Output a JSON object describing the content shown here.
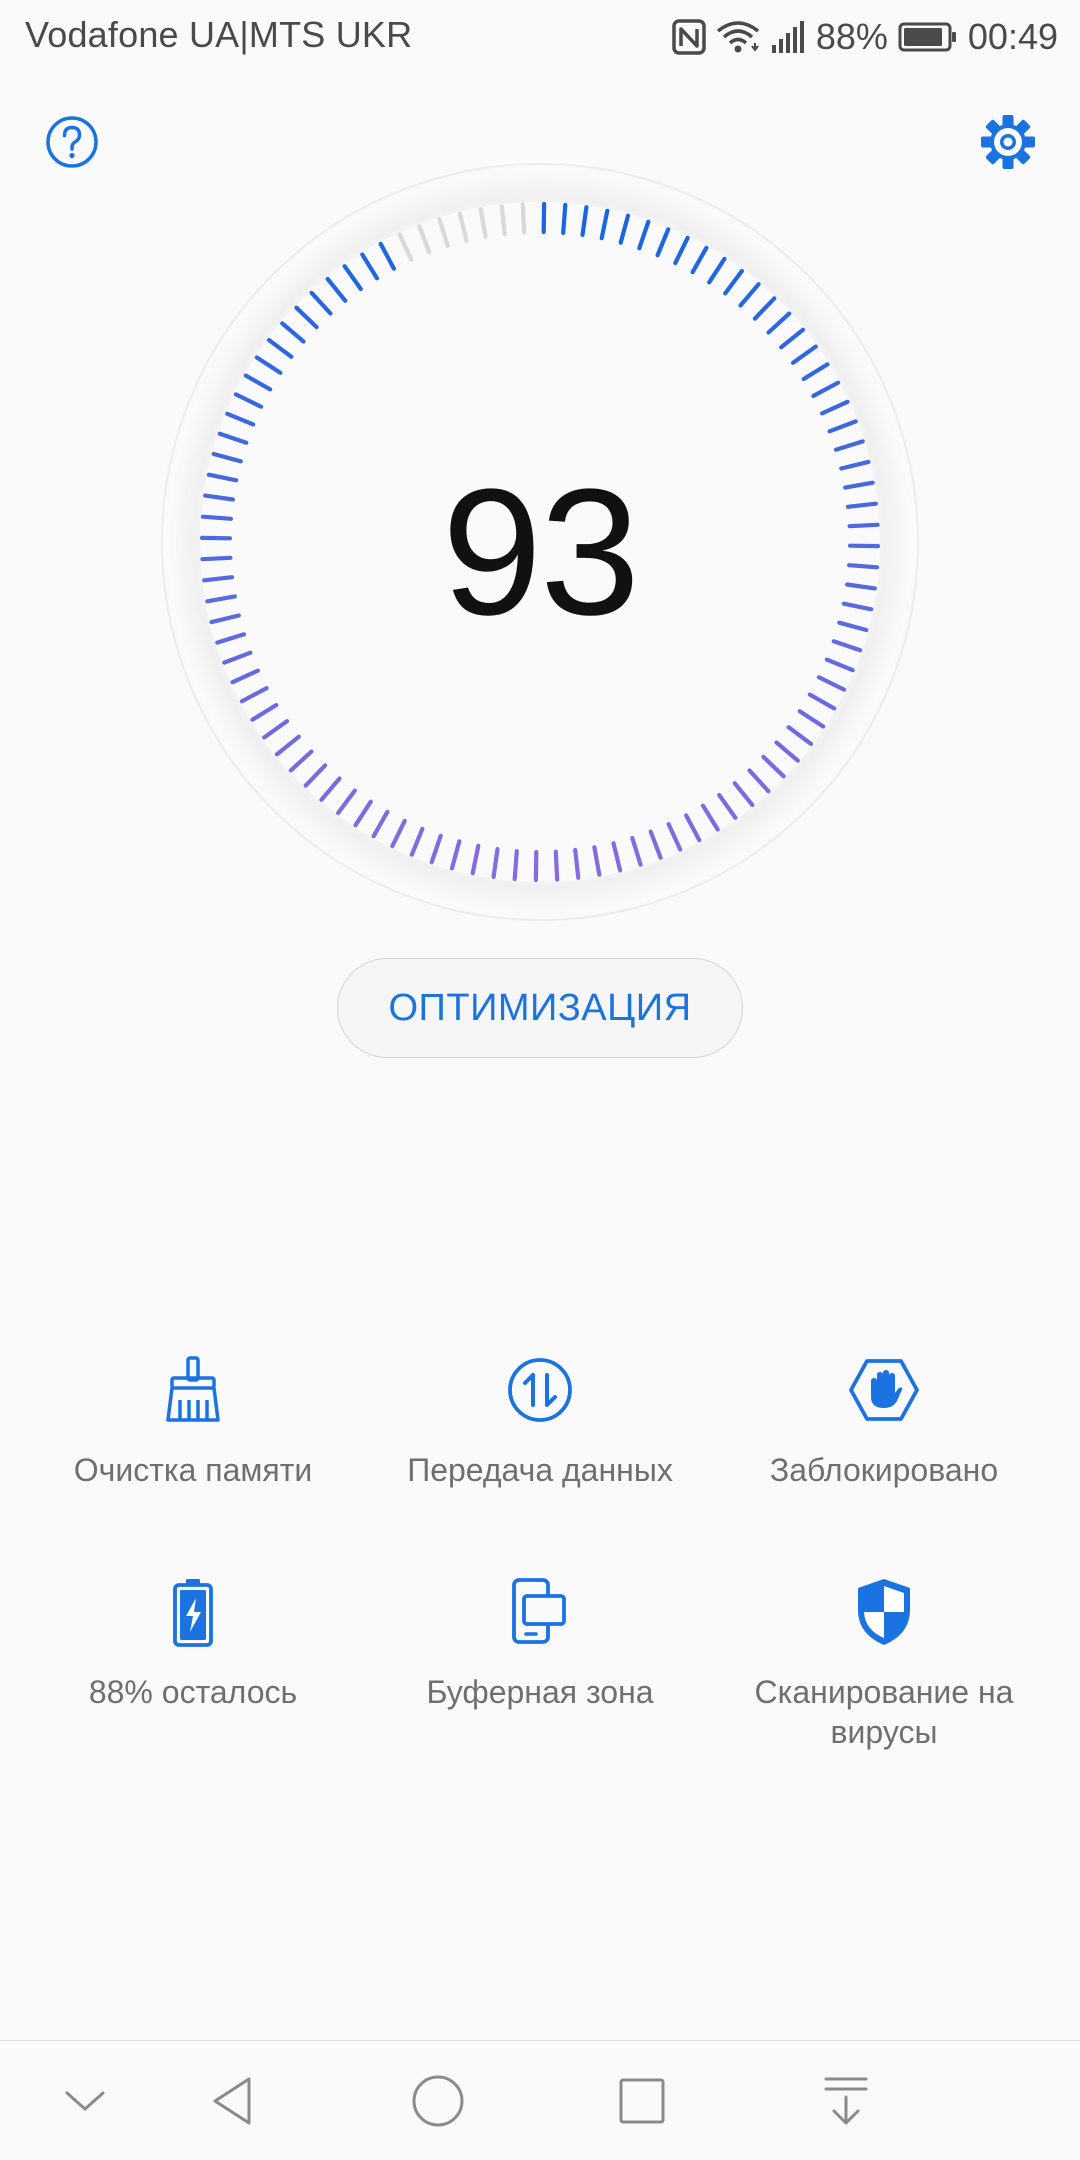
{
  "status_bar": {
    "carrier": "Vodafone UA|MTS UKR",
    "battery_percent": "88%",
    "time": "00:49"
  },
  "gauge": {
    "score": "93",
    "progress_fraction": 0.93,
    "active_color_start": "#1565e0",
    "active_color_end": "#8a6ce0",
    "inactive_color": "#d9d9d9"
  },
  "optimize_button": {
    "label": "ОПТИМИЗАЦИЯ"
  },
  "features": [
    {
      "label": "Очистка памяти",
      "icon": "broom-icon"
    },
    {
      "label": "Передача данных",
      "icon": "data-transfer-icon"
    },
    {
      "label": "Заблокировано",
      "icon": "blocked-hand-icon"
    },
    {
      "label": "88% осталось",
      "icon": "battery-icon"
    },
    {
      "label": "Буферная зона",
      "icon": "buffer-zone-icon"
    },
    {
      "label": "Сканирование на вирусы",
      "icon": "virus-scan-shield-icon"
    }
  ],
  "colors": {
    "accent": "#1a73e0",
    "text_secondary": "#6f6f6f",
    "background": "#fafafa"
  },
  "navigation": {
    "icons": [
      "chevron-down-icon",
      "back-icon",
      "home-icon",
      "recents-icon",
      "notifications-pull-icon"
    ]
  }
}
